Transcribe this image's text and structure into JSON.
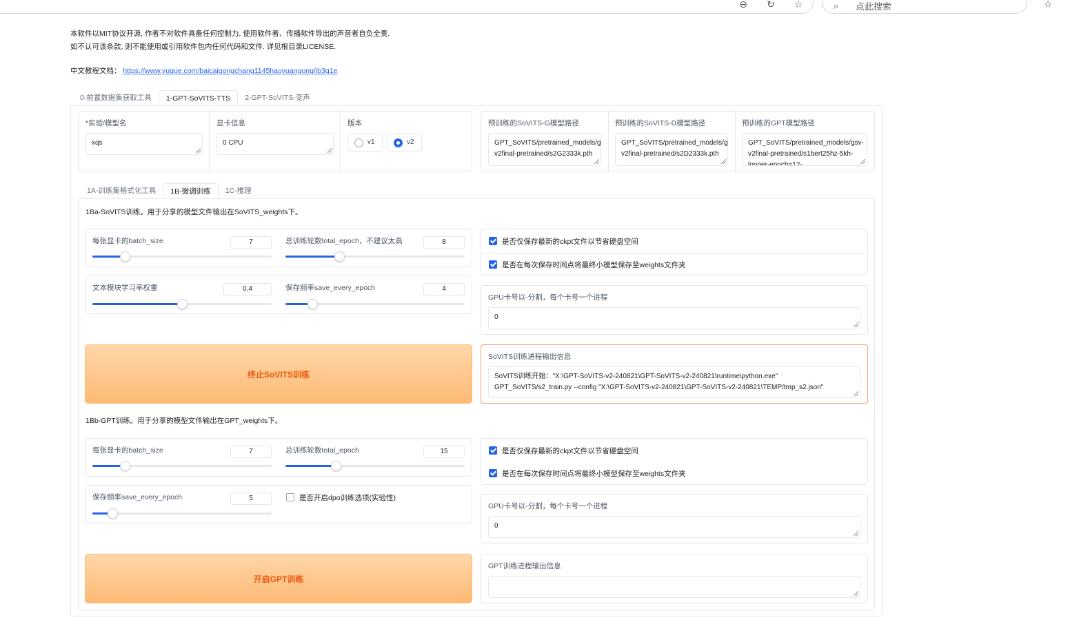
{
  "browser": {
    "search_placeholder": "点此搜索",
    "icons": [
      "zoom-out-icon",
      "refresh-icon",
      "star-icon",
      "search-icon",
      "favorites-icon"
    ]
  },
  "notice": {
    "line1": "本软件以MIT协议开源, 作者不对软件具备任何控制力, 使用软件者、传播软件导出的声音者自负全责.",
    "line2": "如不认可该条款, 则不能使用或引用软件包内任何代码和文件. 详见根目录LICENSE."
  },
  "doc": {
    "label": "中文教程文档：",
    "link": "https://www.yuque.com/baicaigongchang1145haoyuangong/ib3g1e"
  },
  "main_tabs": [
    "0-前置数据集获取工具",
    "1-GPT-SoVITS-TTS",
    "2-GPT-SoVITS-变声"
  ],
  "settings": {
    "exp_name_label": "*实验/模型名",
    "exp_name_value": "xqs",
    "gpu_info_label": "显卡信息",
    "gpu_info_value": "0 CPU",
    "version_label": "版本",
    "version_options": [
      "v1",
      "v2"
    ],
    "version_selected": "v2",
    "sovits_g_label": "预训练的SoVITS-G模型路径",
    "sovits_g_value": "GPT_SoVITS/pretrained_models/gsv-v2final-pretrained/s2G2333k.pth",
    "sovits_d_label": "预训练的SoVITS-D模型路径",
    "sovits_d_value": "GPT_SoVITS/pretrained_models/gsv-v2final-pretrained/s2D2333k.pth",
    "gpt_label": "预训练的GPT模型路径",
    "gpt_value": "GPT_SoVITS/pretrained_models/gsv-v2final-pretrained/s1bert25hz-5kh-longer-epoch=12-"
  },
  "sub_tabs": [
    "1A-训练集格式化工具",
    "1B-微调训练",
    "1C-推理"
  ],
  "sovits": {
    "title": "1Ba-SoVITS训练。用于分享的模型文件输出在SoVITS_weights下。",
    "batch_size_label": "每张显卡的batch_size",
    "batch_size_value": "7",
    "batch_size_fraction": 0.18,
    "epoch_label": "总训练轮数total_epoch，不建议太高",
    "epoch_value": "8",
    "epoch_fraction": 0.3,
    "text_lr_label": "文本模块学习率权重",
    "text_lr_value": "0.4",
    "text_lr_fraction": 0.5,
    "save_every_label": "保存频率save_every_epoch",
    "save_every_value": "4",
    "save_every_fraction": 0.15,
    "save_latest_label": "是否仅保存最新的ckpt文件以节省硬盘空间",
    "save_latest_checked": true,
    "save_weights_label": "是否在每次保存时间点将最终小模型保存至weights文件夹",
    "save_weights_checked": true,
    "gpu_ids_label": "GPU卡号以-分割，每个卡号一个进程",
    "gpu_ids_value": "0",
    "button_label": "终止SoVITS训练",
    "output_label": "SoVITS训练进程输出信息",
    "output_value": "SoVITS训练开始：\"X:\\GPT-SoVITS-v2-240821\\GPT-SoVITS-v2-240821\\runtime\\python.exe\" GPT_SoVITS/s2_train.py --config \"X:\\GPT-SoVITS-v2-240821\\GPT-SoVITS-v2-240821\\TEMP/tmp_s2.json\""
  },
  "gpt": {
    "title": "1Bb-GPT训练。用于分享的模型文件输出在GPT_weights下。",
    "batch_size_label": "每张显卡的batch_size",
    "batch_size_value": "7",
    "batch_size_fraction": 0.18,
    "epoch_label": "总训练轮数total_epoch",
    "epoch_value": "15",
    "epoch_fraction": 0.28,
    "save_every_label": "保存频率save_every_epoch",
    "save_every_value": "5",
    "save_every_fraction": 0.11,
    "dpo_label": "是否开启dpo训练选项(实验性)",
    "dpo_checked": false,
    "save_latest_label": "是否仅保存最新的ckpt文件以节省硬盘空间",
    "save_latest_checked": true,
    "save_weights_label": "是否在每次保存时间点将最终小模型保存至weights文件夹",
    "save_weights_checked": true,
    "gpu_ids_label": "GPU卡号以-分割，每个卡号一个进程",
    "gpu_ids_value": "0",
    "button_label": "开启GPT训练",
    "output_label": "GPT训练进程输出信息",
    "output_value": ""
  },
  "colors": {
    "accent": "#2563eb",
    "button_text": "#ea580c",
    "button_bg": "#fdba74"
  }
}
